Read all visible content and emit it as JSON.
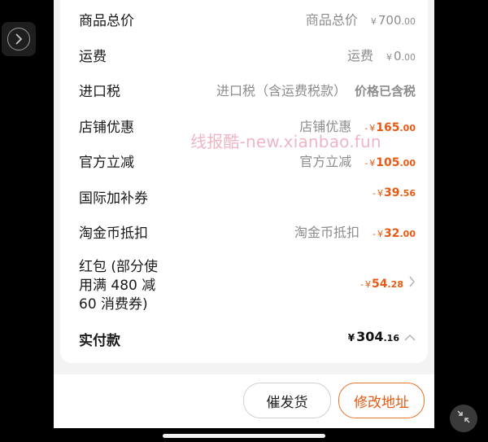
{
  "rows": [
    {
      "label": "商品总价",
      "desc": "商品总价",
      "cur": "¥",
      "main": "700",
      "small": ".00"
    },
    {
      "label": "运费",
      "desc": "运费",
      "cur": "¥",
      "main": "0",
      "small": ".00"
    },
    {
      "label": "进口税",
      "desc": "进口税（含运费税款）",
      "note": "价格已含税"
    },
    {
      "label": "店铺优惠",
      "desc": "店铺优惠",
      "sign": "-",
      "cur": "¥",
      "main": "165",
      "small": ".00"
    },
    {
      "label": "官方立减",
      "desc": "官方立减",
      "sign": "-",
      "cur": "¥",
      "main": "105",
      "small": ".00"
    },
    {
      "label": "国际加补券",
      "sign": "-",
      "cur": "¥",
      "main": "39",
      "small": ".56"
    },
    {
      "label": "淘金币抵扣",
      "desc": "淘金币抵扣",
      "sign": "-",
      "cur": "¥",
      "main": "32",
      "small": ".00"
    },
    {
      "label": "红包 (部分使用满 480 减 60 消费券)",
      "sign": "-",
      "cur": "¥",
      "main": "54",
      "small": ".28"
    }
  ],
  "total": {
    "label": "实付款",
    "cur": "¥",
    "main": "304",
    "small": ".16"
  },
  "watermark": "线报酷-new.xianbao.fun",
  "buttons": {
    "remind": "催发货",
    "address": "修改地址"
  },
  "colors": {
    "accent": "#e65a14",
    "gray_text": "#8c8c8c"
  },
  "icons": {
    "side_button": "chevron-right-icon",
    "minimize": "collapse-arrows-icon",
    "redpacket": "chevron-right-icon",
    "total": "chevron-up-icon"
  }
}
